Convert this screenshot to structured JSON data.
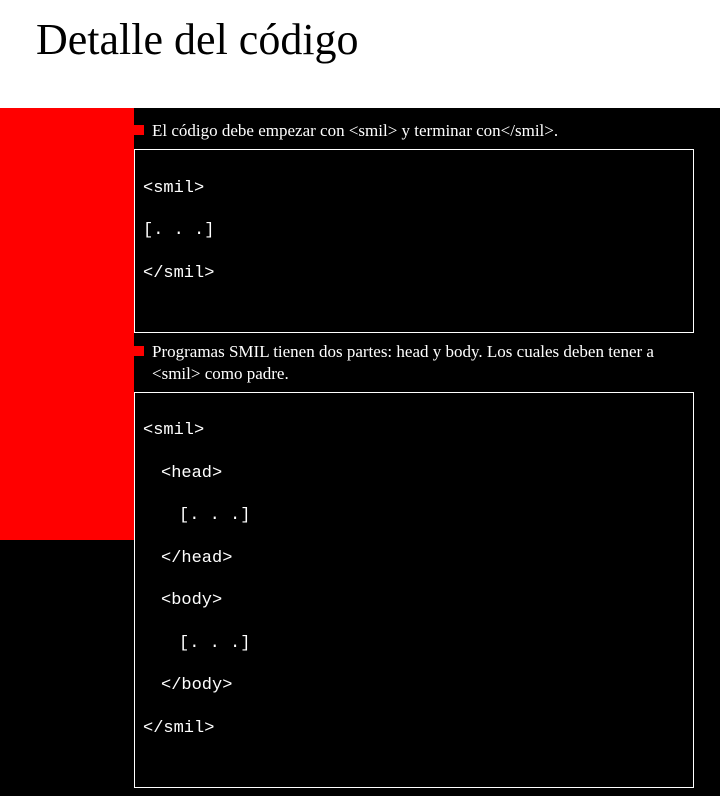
{
  "title": "Detalle del código",
  "para1": "El código debe empezar con <smil> y terminar con</smil>.",
  "code1": {
    "l1": "<smil>",
    "l2": "[. . .]",
    "l3": "</smil>"
  },
  "para2": "Programas SMIL tienen dos partes: head y body. Los cuales deben tener a <smil> como padre.",
  "code2": {
    "l1": "<smil>",
    "l2": "<head>",
    "l3": "[. . .]",
    "l4": "</head>",
    "l5": "<body>",
    "l6": "[. . .]",
    "l7": "</body>",
    "l8": "</smil>"
  }
}
